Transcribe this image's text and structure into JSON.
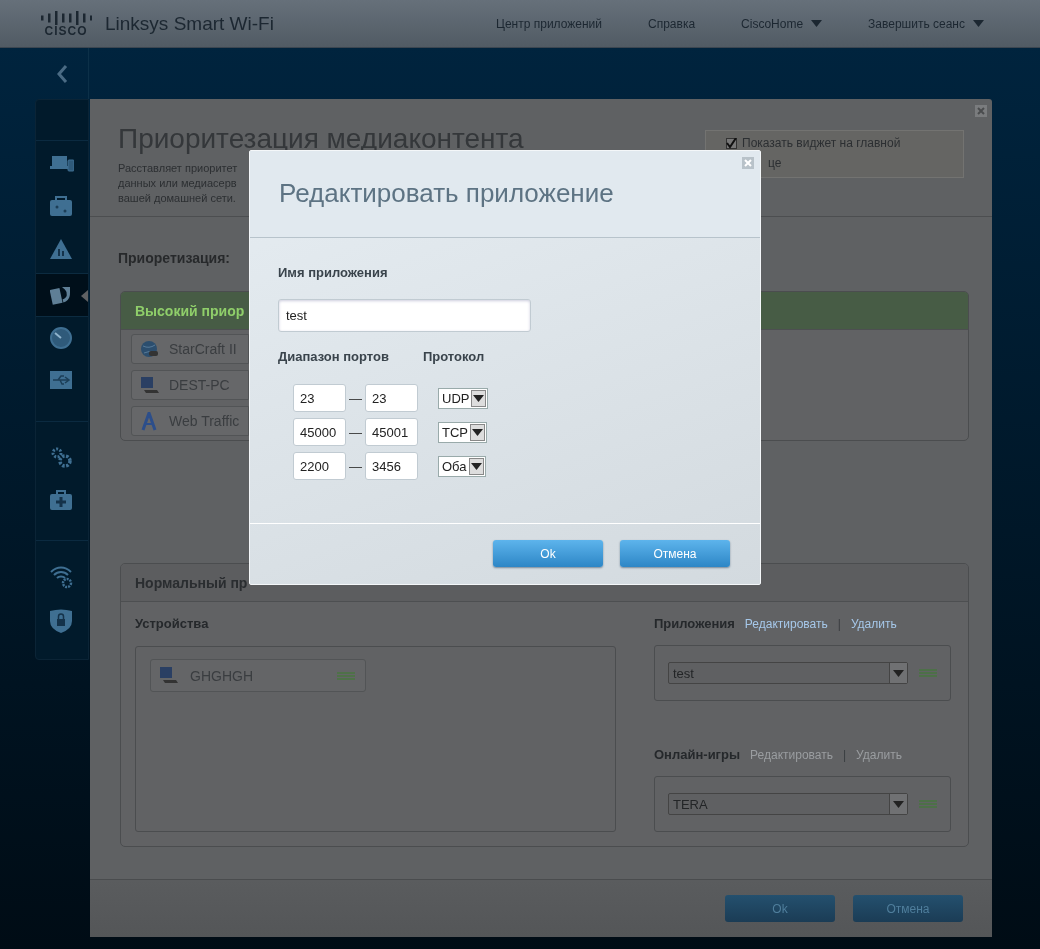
{
  "header": {
    "logo_text": "CISCO",
    "brand": "Linksys Smart Wi-Fi",
    "nav": [
      {
        "label": "Центр приложений",
        "dropdown": false
      },
      {
        "label": "Справка",
        "dropdown": false
      },
      {
        "label": "CiscoHome",
        "dropdown": true
      },
      {
        "label": "Завершить сеанс",
        "dropdown": true
      }
    ]
  },
  "sidebar": {
    "sections": [
      {
        "items": [
          {
            "kind": "devices",
            "selected": false
          },
          {
            "kind": "toolbox",
            "selected": false
          },
          {
            "kind": "parental",
            "selected": false
          },
          {
            "kind": "media",
            "selected": true
          },
          {
            "kind": "speed",
            "selected": false
          },
          {
            "kind": "usb",
            "selected": false
          }
        ]
      },
      {
        "items": [
          {
            "kind": "settings",
            "selected": false
          },
          {
            "kind": "troubleshoot",
            "selected": false
          }
        ]
      },
      {
        "items": [
          {
            "kind": "wifi",
            "selected": false
          },
          {
            "kind": "security",
            "selected": false
          }
        ]
      }
    ]
  },
  "panel": {
    "title": "Приоритезация медиаконтента",
    "description": [
      "Расставляет приоритет",
      "данных или медиасерв",
      "вашей домашней сети."
    ],
    "widget_checkbox": {
      "lines": [
        "Показать виджет на главной",
        "це"
      ],
      "checked": true
    },
    "priority_label": "Приоретизация:",
    "high": {
      "title": "Высокий приор",
      "items": [
        {
          "name": "StarCraft II",
          "kind": "game"
        },
        {
          "name": "DEST-PC",
          "kind": "computer"
        },
        {
          "name": "Web Traffic",
          "kind": "web"
        }
      ]
    },
    "normal": {
      "title": "Нормальный пр",
      "devices_label": "Устройства",
      "devices": [
        {
          "name": "GHGHGH",
          "kind": "computer"
        }
      ],
      "groups": [
        {
          "title": "Приложения",
          "actions": [
            {
              "label": "Редактировать",
              "disabled": false
            },
            {
              "label": "Удалить",
              "disabled": false
            }
          ],
          "separator": "|",
          "value": "test"
        },
        {
          "title": "Онлайн-игры",
          "actions": [
            {
              "label": "Редактировать",
              "disabled": true
            },
            {
              "label": "Удалить",
              "disabled": true
            }
          ],
          "separator": "|",
          "value": "TERA"
        }
      ]
    },
    "buttons": [
      "Ok",
      "Отмена"
    ]
  },
  "dialog": {
    "title": "Редактировать приложение",
    "name_label": "Имя приложения",
    "name_value": "test",
    "ports_label": "Диапазон портов",
    "protocol_label": "Протокол",
    "ranges": [
      {
        "from": "23",
        "separator": "—",
        "to": "23",
        "protocol": "UDP"
      },
      {
        "from": "45000",
        "separator": "—",
        "to": "45001",
        "protocol": "TCP"
      },
      {
        "from": "2200",
        "separator": "—",
        "to": "3456",
        "protocol": "Оба"
      }
    ],
    "buttons": [
      "Ok",
      "Отмена"
    ]
  }
}
